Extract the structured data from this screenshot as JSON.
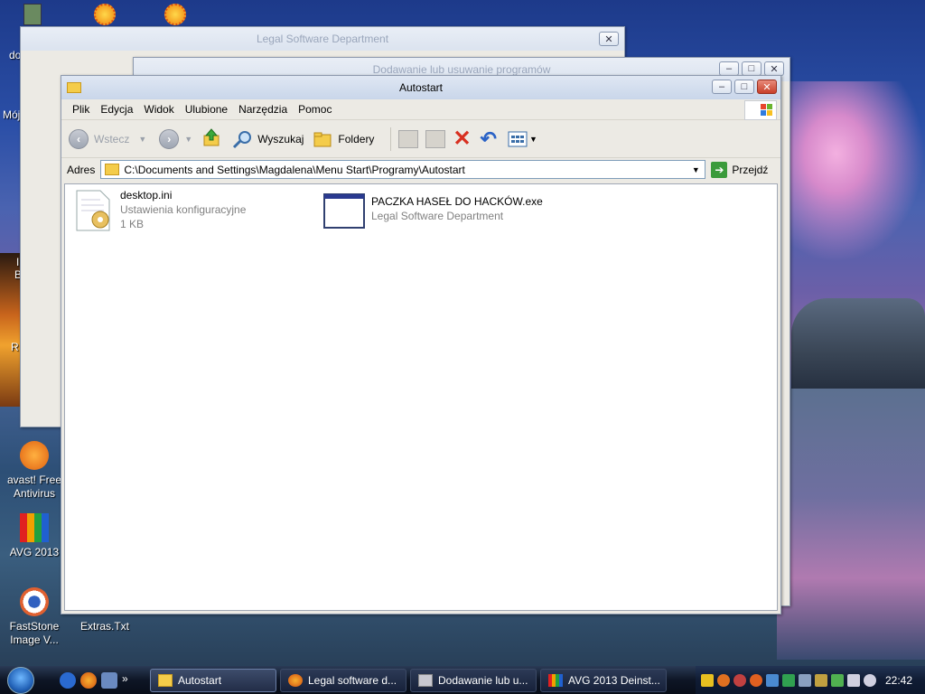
{
  "desktop": {
    "icons": [
      {
        "label": "avast! Free Antivirus"
      },
      {
        "label": "AVG 2013"
      },
      {
        "label": "FastStone Image V..."
      },
      {
        "label": "Extras.Txt"
      }
    ],
    "partial_labels": {
      "do": "do",
      "moj": "Mój",
      "b1": "I",
      "b2": "B",
      "r": "R"
    }
  },
  "bg_window_1": {
    "title": "Legal Software Department"
  },
  "bg_window_2": {
    "title": "Dodawanie lub usuwanie programów"
  },
  "explorer": {
    "title": "Autostart",
    "menu": [
      "Plik",
      "Edycja",
      "Widok",
      "Ulubione",
      "Narzędzia",
      "Pomoc"
    ],
    "toolbar": {
      "back": "Wstecz",
      "search": "Wyszukaj",
      "folders": "Foldery"
    },
    "address": {
      "label": "Adres",
      "value": "C:\\Documents and Settings\\Magdalena\\Menu Start\\Programy\\Autostart",
      "go": "Przejdź"
    },
    "files": [
      {
        "name": "desktop.ini",
        "type": "Ustawienia konfiguracyjne",
        "size": "1 KB"
      },
      {
        "name": "PACZKA HASEŁ DO HACKÓW.exe",
        "type": "Legal Software Department"
      }
    ]
  },
  "taskbar": {
    "tasks": [
      {
        "label": "Autostart"
      },
      {
        "label": "Legal software d..."
      },
      {
        "label": "Dodawanie lub u..."
      },
      {
        "label": "AVG 2013 Deinst..."
      }
    ],
    "quicklaunch_more": "»",
    "clock": "22:42"
  },
  "colors": {
    "accent": "#2363b8",
    "close_red": "#c8402a",
    "delete_red": "#d83020",
    "go_green": "#3b9b3b"
  }
}
